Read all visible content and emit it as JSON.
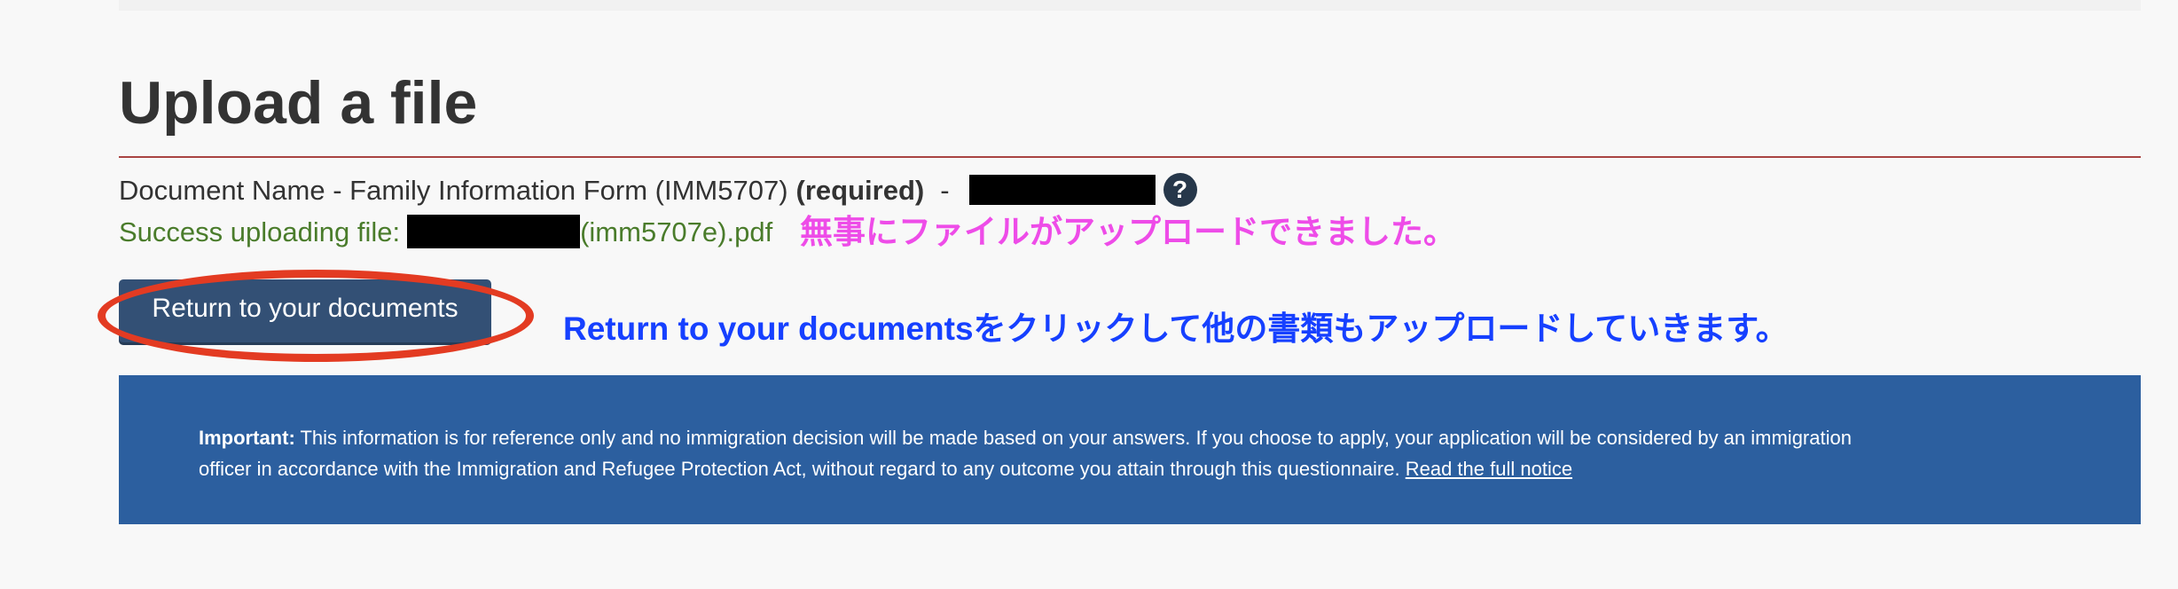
{
  "page": {
    "title": "Upload a file"
  },
  "document": {
    "prefix": "Document Name - Family Information Form (IMM5707)",
    "required": "(required)",
    "separator": "-",
    "help_icon_name": "question-circle-icon",
    "help_symbol": "?"
  },
  "upload": {
    "success_prefix": "Success uploading file:",
    "file_suffix": "(imm5707e).pdf",
    "annotation": "無事にファイルがアップロードできました。"
  },
  "actions": {
    "return_label": "Return to your documents",
    "return_annotation": "Return to your documentsをクリックして他の書類もアップロードしていきます。"
  },
  "notice": {
    "label": "Important:",
    "text": " This information is for reference only and no immigration decision will be made based on your answers. If you choose to apply, your application will be considered by an immigration\nofficer in accordance with the Immigration and Refugee Protection Act, without regard to any outcome you attain through this questionnaire. ",
    "link": "Read the full notice"
  },
  "colors": {
    "background": "#f8f8f8",
    "title_rule": "#a94442",
    "success_text": "#4a7c2b",
    "button": "#335075",
    "notice_panel": "#2c5f9f",
    "pink_annotation": "#ee4ce8",
    "blue_annotation": "#1640ff",
    "red_highlight": "#e33b22"
  }
}
